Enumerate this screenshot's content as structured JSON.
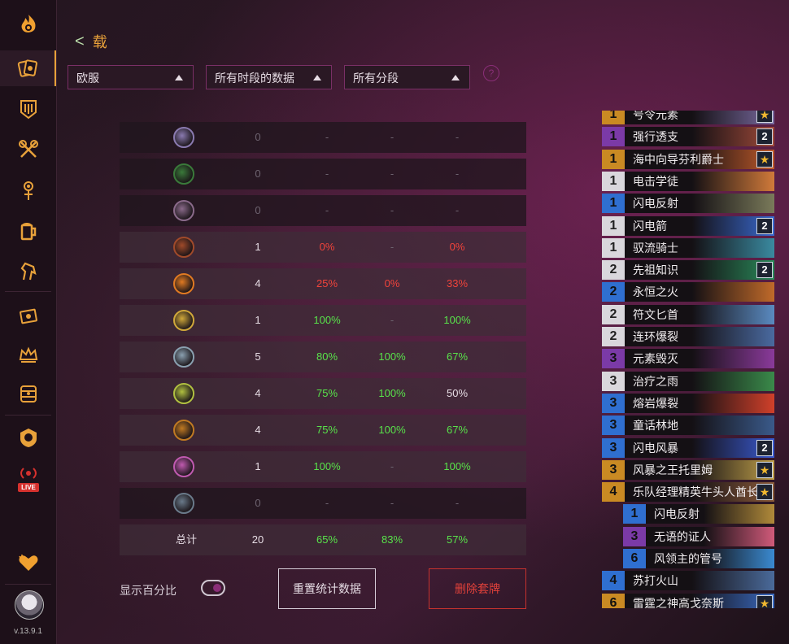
{
  "app": {
    "version": "v.13.9.1",
    "live_badge": "LIVE"
  },
  "sidebar": {
    "icons": [
      "flame-logo-icon",
      "cards-icon",
      "deck-icon",
      "crossed-axes-icon",
      "ornament-icon",
      "tankard-icon",
      "horse-icon",
      "ticket-icon",
      "crown-icon",
      "dungeon-icon",
      "battlegrounds-icon",
      "live-broadcast-icon",
      "heart-icon",
      "avatar"
    ]
  },
  "header": {
    "back_glyph": "<",
    "title": "载"
  },
  "filters": {
    "region": "欧服",
    "period": "所有时段的数据",
    "rank": "所有分段",
    "help": "?"
  },
  "stats": {
    "rows": [
      {
        "icon": "class-icon-1",
        "games": "0",
        "c2": "-",
        "c3": "-",
        "c4": "-",
        "col": [
          "dim",
          "dim",
          "dim",
          "dim"
        ],
        "ring": "#8a7ab0"
      },
      {
        "icon": "class-icon-2",
        "games": "0",
        "c2": "-",
        "c3": "-",
        "c4": "-",
        "col": [
          "dim",
          "dim",
          "dim",
          "dim"
        ],
        "ring": "#3a7a3a"
      },
      {
        "icon": "class-icon-3",
        "games": "0",
        "c2": "-",
        "c3": "-",
        "c4": "-",
        "col": [
          "dim",
          "dim",
          "dim",
          "dim"
        ],
        "ring": "#8a6a8a"
      },
      {
        "icon": "class-icon-4",
        "games": "1",
        "c2": "0%",
        "c3": "-",
        "c4": "0%",
        "col": [
          "white",
          "red",
          "dim",
          "red"
        ],
        "ring": "#a04a2a"
      },
      {
        "icon": "class-icon-5",
        "games": "4",
        "c2": "25%",
        "c3": "0%",
        "c4": "33%",
        "col": [
          "white",
          "red",
          "red",
          "red"
        ],
        "ring": "#e07a22"
      },
      {
        "icon": "class-icon-6",
        "games": "1",
        "c2": "100%",
        "c3": "-",
        "c4": "100%",
        "col": [
          "white",
          "green",
          "dim",
          "green"
        ],
        "ring": "#d0a83a"
      },
      {
        "icon": "class-icon-7",
        "games": "5",
        "c2": "80%",
        "c3": "100%",
        "c4": "67%",
        "col": [
          "white",
          "green",
          "green",
          "green"
        ],
        "ring": "#8aa0b0"
      },
      {
        "icon": "class-icon-8",
        "games": "4",
        "c2": "75%",
        "c3": "100%",
        "c4": "50%",
        "col": [
          "white",
          "green",
          "green",
          "white"
        ],
        "ring": "#b0c040"
      },
      {
        "icon": "class-icon-9",
        "games": "4",
        "c2": "75%",
        "c3": "100%",
        "c4": "67%",
        "col": [
          "white",
          "green",
          "green",
          "green"
        ],
        "ring": "#c07a22"
      },
      {
        "icon": "class-icon-10",
        "games": "1",
        "c2": "100%",
        "c3": "-",
        "c4": "100%",
        "col": [
          "white",
          "green",
          "dim",
          "green"
        ],
        "ring": "#c05ab0"
      },
      {
        "icon": "class-icon-11",
        "games": "0",
        "c2": "-",
        "c3": "-",
        "c4": "-",
        "col": [
          "dim",
          "dim",
          "dim",
          "dim"
        ],
        "ring": "#6a7a8a"
      }
    ],
    "total": {
      "label": "总计",
      "games": "20",
      "c2": "65%",
      "c3": "83%",
      "c4": "57%"
    }
  },
  "controls": {
    "show_percent_label": "显示百分比",
    "reset_label": "重置统计数据",
    "delete_label": "删除套牌"
  },
  "deck": [
    {
      "cost": "1",
      "name": "号令元素",
      "rarity": "o",
      "count": "★",
      "art": "#7a6aa0"
    },
    {
      "cost": "1",
      "name": "强行透支",
      "rarity": "p",
      "count": "2",
      "art": "#a04a3a"
    },
    {
      "cost": "1",
      "name": "海中向导芬利爵士",
      "rarity": "o",
      "count": "★",
      "art": "#c05a2a"
    },
    {
      "cost": "1",
      "name": "电击学徒",
      "rarity": "w",
      "count": "",
      "art": "#d07a3a"
    },
    {
      "cost": "1",
      "name": "闪电反射",
      "rarity": "b",
      "count": "",
      "art": "#7a7a5a"
    },
    {
      "cost": "1",
      "name": "闪电箭",
      "rarity": "w",
      "count": "2",
      "art": "#3a6ad0"
    },
    {
      "cost": "1",
      "name": "驭流骑士",
      "rarity": "w",
      "count": "",
      "art": "#3a8aa0"
    },
    {
      "cost": "2",
      "name": "先祖知识",
      "rarity": "w",
      "count": "2",
      "art": "#2a8a5a"
    },
    {
      "cost": "2",
      "name": "永恒之火",
      "rarity": "b",
      "count": "",
      "art": "#c06a2a"
    },
    {
      "cost": "2",
      "name": "符文匕首",
      "rarity": "w",
      "count": "",
      "art": "#5a8ac0"
    },
    {
      "cost": "2",
      "name": "连环爆裂",
      "rarity": "w",
      "count": "",
      "art": "#4a6aa0"
    },
    {
      "cost": "3",
      "name": "元素毁灭",
      "rarity": "p",
      "count": "",
      "art": "#8a3a9a"
    },
    {
      "cost": "3",
      "name": "治疗之雨",
      "rarity": "w",
      "count": "",
      "art": "#3a8a4a"
    },
    {
      "cost": "3",
      "name": "熔岩爆裂",
      "rarity": "b",
      "count": "",
      "art": "#d0402a"
    },
    {
      "cost": "3",
      "name": "童话林地",
      "rarity": "b",
      "count": "",
      "art": "#3a5a8a"
    },
    {
      "cost": "3",
      "name": "闪电风暴",
      "rarity": "b",
      "count": "2",
      "art": "#3a5ad0"
    },
    {
      "cost": "3",
      "name": "风暴之王托里姆",
      "rarity": "o",
      "count": "★",
      "art": "#c0a04a"
    },
    {
      "cost": "4",
      "name": "乐队经理精英牛头人酋长",
      "rarity": "o",
      "count": "★",
      "art": "#8a5a3a"
    },
    {
      "cost": "1",
      "name": "闪电反射",
      "rarity": "b",
      "count": "",
      "art": "#b08a3a",
      "indent": true
    },
    {
      "cost": "3",
      "name": "无语的证人",
      "rarity": "p",
      "count": "",
      "art": "#d05a7a",
      "indent": true
    },
    {
      "cost": "6",
      "name": "风领主的管号",
      "rarity": "b",
      "count": "",
      "art": "#3a8ad0",
      "indent": true
    },
    {
      "cost": "4",
      "name": "苏打火山",
      "rarity": "b",
      "count": "",
      "art": "#4a6a9a"
    },
    {
      "cost": "6",
      "name": "雷霆之神高戈奈斯",
      "rarity": "o",
      "count": "★",
      "art": "#3a6ac0"
    }
  ]
}
